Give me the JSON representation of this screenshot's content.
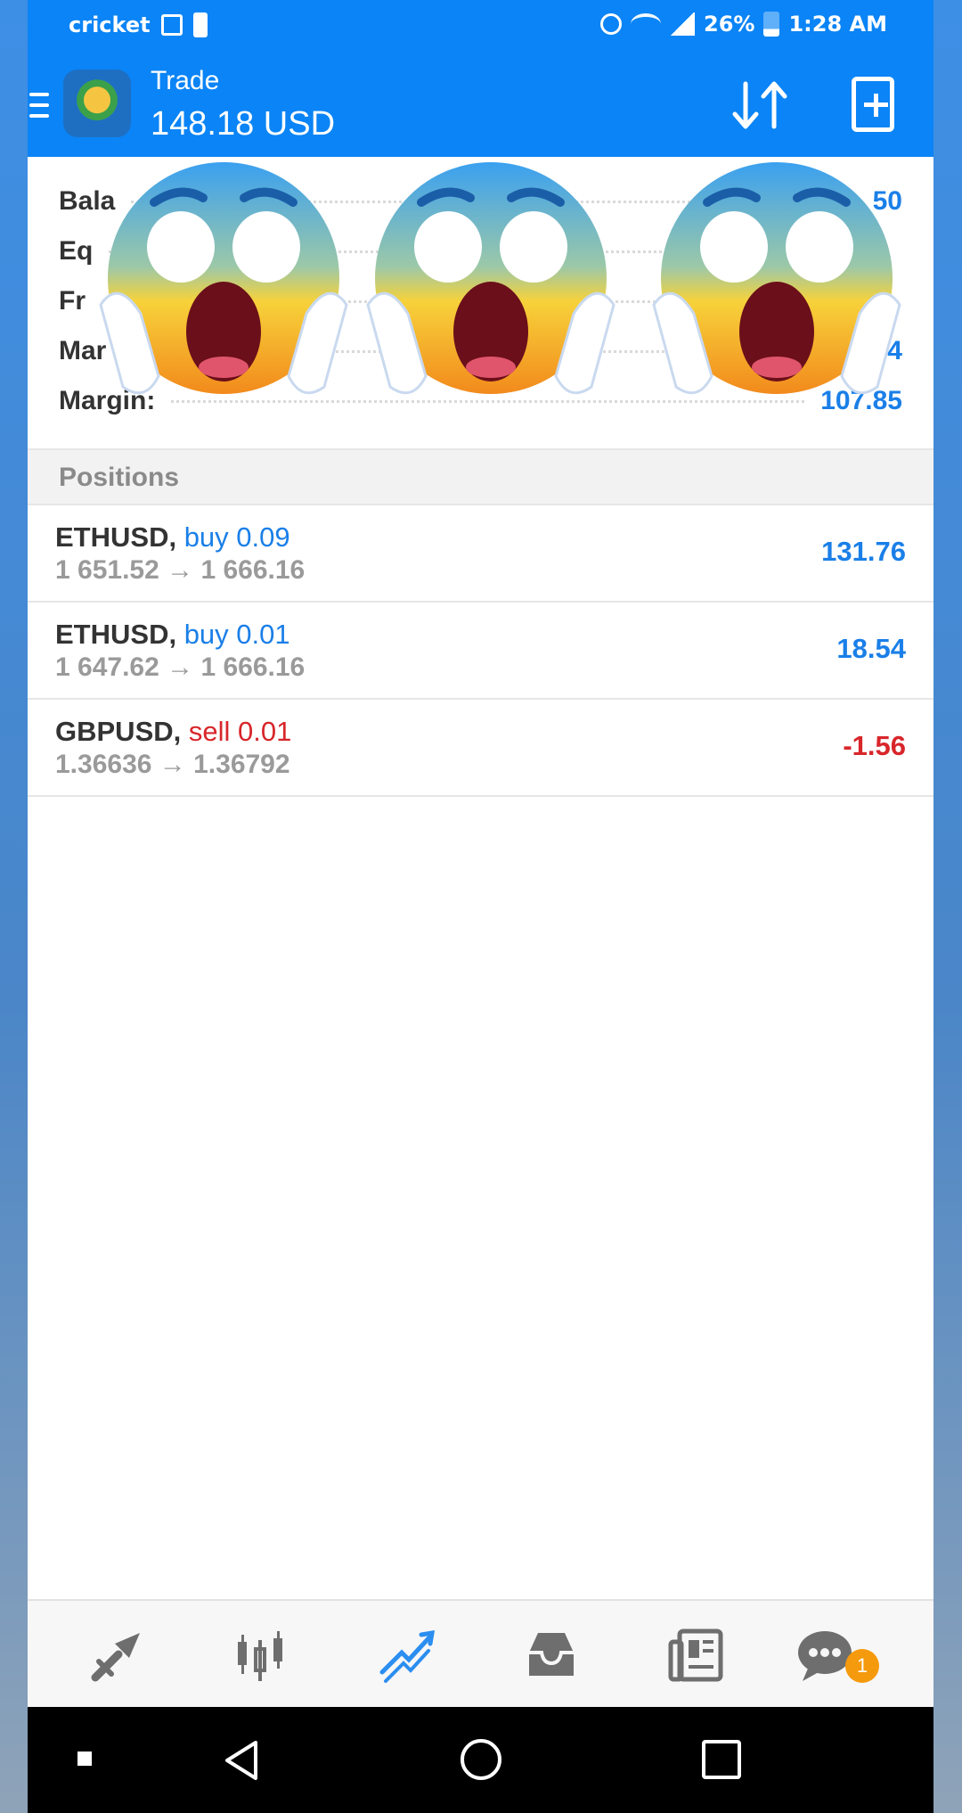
{
  "status_bar": {
    "carrier": "cricket",
    "battery_percent": "26%",
    "time": "1:28 AM"
  },
  "header": {
    "title": "Trade",
    "subtitle": "148.18 USD",
    "icons": [
      "menu-icon",
      "sort-icon",
      "new-order-icon"
    ]
  },
  "summary": {
    "rows": [
      {
        "label": "Bala",
        "value": "50"
      },
      {
        "label": "Eq",
        "value": ""
      },
      {
        "label": "Fr",
        "value": ""
      },
      {
        "label": "Mar",
        "value": "54"
      },
      {
        "label": "Margin:",
        "value": "107.85"
      }
    ],
    "overlay_emoji": "😱"
  },
  "positions": {
    "header": "Positions",
    "items": [
      {
        "symbol": "ETHUSD",
        "side": "buy 0.09",
        "prices": "1 651.52 → 1 666.16",
        "profit": "131.76"
      },
      {
        "symbol": "ETHUSD",
        "side": "buy 0.01",
        "prices": "1 647.62 → 1 666.16",
        "profit": "18.54"
      },
      {
        "symbol": "GBPUSD",
        "side": "sell 0.01",
        "prices": "1.36636 → 1.36792",
        "profit": "-1.56"
      }
    ]
  },
  "bottom_nav": {
    "items": [
      "quotes-icon",
      "chart-icon",
      "trade-icon",
      "history-icon",
      "news-icon",
      "chat-icon"
    ],
    "active": "trade-icon",
    "chat_badge": "1"
  },
  "colors": {
    "header_blue": "#0a84f6",
    "value_blue": "#1a7fe8",
    "negative_red": "#d8262b",
    "badge_orange": "#f59a0c"
  }
}
